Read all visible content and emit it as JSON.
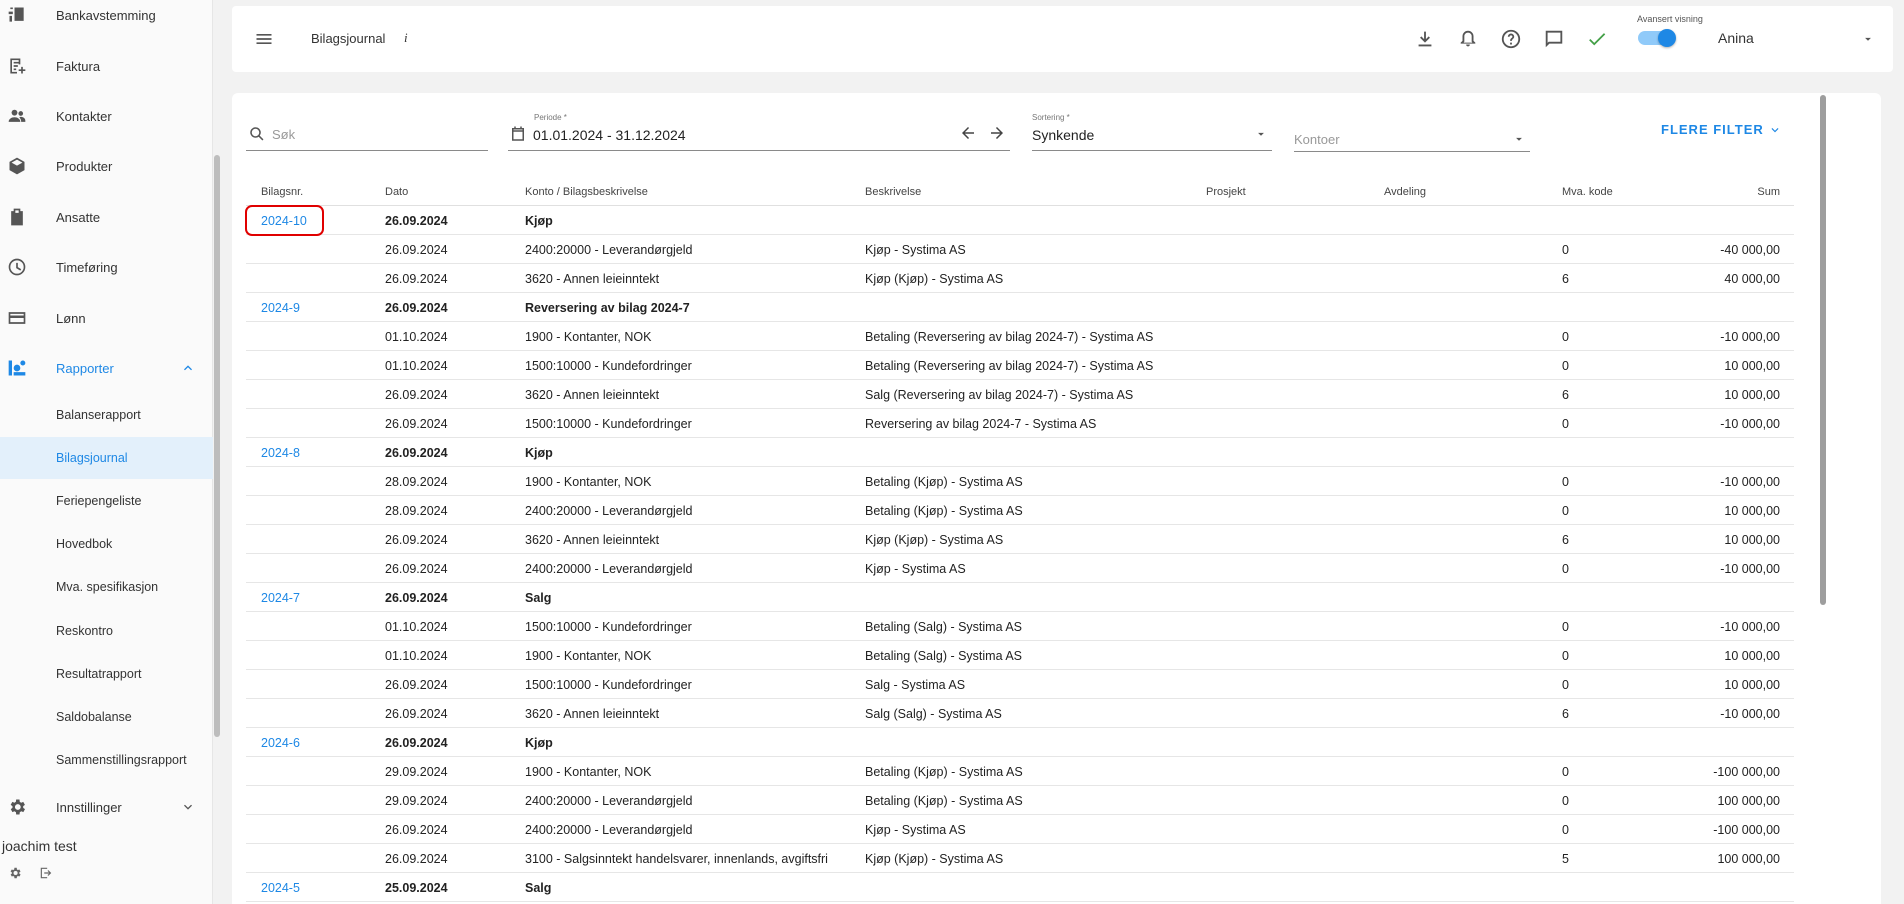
{
  "sidebar": {
    "items": [
      {
        "label": "Bankavstemming",
        "icon": "bank-reconciliation-icon"
      },
      {
        "label": "Faktura",
        "icon": "invoice-icon"
      },
      {
        "label": "Kontakter",
        "icon": "contacts-icon"
      },
      {
        "label": "Produkter",
        "icon": "products-box-icon"
      },
      {
        "label": "Ansatte",
        "icon": "employees-badge-icon"
      },
      {
        "label": "Timeføring",
        "icon": "clock-icon"
      },
      {
        "label": "Lønn",
        "icon": "payroll-card-icon"
      },
      {
        "label": "Rapporter",
        "icon": "reports-icon"
      }
    ],
    "report_subitems": [
      "Balanserapport",
      "Bilagsjournal",
      "Feriepengeliste",
      "Hovedbok",
      "Mva. spesifikasjon",
      "Reskontro",
      "Resultatrapport",
      "Saldobalanse",
      "Sammenstillingsrapport"
    ],
    "settings_label": "Innstillinger",
    "user_name": "joachim test"
  },
  "topbar": {
    "title": "Bilagsjournal",
    "info": "i",
    "advanced_view_label": "Avansert visning",
    "advanced_view_on": true,
    "user": "Anina",
    "accent": "#1e88e5"
  },
  "filters": {
    "search_placeholder": "Søk",
    "period_label": "Periode *",
    "period_value": "01.01.2024 - 31.12.2024",
    "sort_label": "Sortering *",
    "sort_value": "Synkende",
    "accounts_placeholder": "Kontoer",
    "more_filters": "FLERE FILTER"
  },
  "table": {
    "headers": {
      "bilagsnr": "Bilagsnr.",
      "dato": "Dato",
      "konto": "Konto / Bilagsbeskrivelse",
      "beskrivelse": "Beskrivelse",
      "prosjekt": "Prosjekt",
      "avdeling": "Avdeling",
      "mva": "Mva. kode",
      "sum": "Sum"
    },
    "rows": [
      {
        "type": "header",
        "nr": "2024-10",
        "date": "26.09.2024",
        "desc": "Kjøp"
      },
      {
        "type": "line",
        "date": "26.09.2024",
        "account": "2400:20000 - Leverandørgjeld",
        "text": "Kjøp - Systima AS",
        "mva": "0",
        "sum": "-40 000,00"
      },
      {
        "type": "line",
        "date": "26.09.2024",
        "account": "3620 - Annen leieinntekt",
        "text": "Kjøp (Kjøp) - Systima AS",
        "mva": "6",
        "sum": "40 000,00"
      },
      {
        "type": "header",
        "nr": "2024-9",
        "date": "26.09.2024",
        "desc": "Reversering av bilag 2024-7"
      },
      {
        "type": "line",
        "date": "01.10.2024",
        "account": "1900 - Kontanter, NOK",
        "text": "Betaling (Reversering av bilag 2024-7) - Systima AS",
        "mva": "0",
        "sum": "-10 000,00"
      },
      {
        "type": "line",
        "date": "01.10.2024",
        "account": "1500:10000 - Kundefordringer",
        "text": "Betaling (Reversering av bilag 2024-7) - Systima AS",
        "mva": "0",
        "sum": "10 000,00"
      },
      {
        "type": "line",
        "date": "26.09.2024",
        "account": "3620 - Annen leieinntekt",
        "text": "Salg (Reversering av bilag 2024-7) - Systima AS",
        "mva": "6",
        "sum": "10 000,00"
      },
      {
        "type": "line",
        "date": "26.09.2024",
        "account": "1500:10000 - Kundefordringer",
        "text": "Reversering av bilag 2024-7 - Systima AS",
        "mva": "0",
        "sum": "-10 000,00"
      },
      {
        "type": "header",
        "nr": "2024-8",
        "date": "26.09.2024",
        "desc": "Kjøp"
      },
      {
        "type": "line",
        "date": "28.09.2024",
        "account": "1900 - Kontanter, NOK",
        "text": "Betaling (Kjøp) - Systima AS",
        "mva": "0",
        "sum": "-10 000,00"
      },
      {
        "type": "line",
        "date": "28.09.2024",
        "account": "2400:20000 - Leverandørgjeld",
        "text": "Betaling (Kjøp) - Systima AS",
        "mva": "0",
        "sum": "10 000,00"
      },
      {
        "type": "line",
        "date": "26.09.2024",
        "account": "3620 - Annen leieinntekt",
        "text": "Kjøp (Kjøp) - Systima AS",
        "mva": "6",
        "sum": "10 000,00"
      },
      {
        "type": "line",
        "date": "26.09.2024",
        "account": "2400:20000 - Leverandørgjeld",
        "text": "Kjøp - Systima AS",
        "mva": "0",
        "sum": "-10 000,00"
      },
      {
        "type": "header",
        "nr": "2024-7",
        "date": "26.09.2024",
        "desc": "Salg"
      },
      {
        "type": "line",
        "date": "01.10.2024",
        "account": "1500:10000 - Kundefordringer",
        "text": "Betaling (Salg) - Systima AS",
        "mva": "0",
        "sum": "-10 000,00"
      },
      {
        "type": "line",
        "date": "01.10.2024",
        "account": "1900 - Kontanter, NOK",
        "text": "Betaling (Salg) - Systima AS",
        "mva": "0",
        "sum": "10 000,00"
      },
      {
        "type": "line",
        "date": "26.09.2024",
        "account": "1500:10000 - Kundefordringer",
        "text": "Salg - Systima AS",
        "mva": "0",
        "sum": "10 000,00"
      },
      {
        "type": "line",
        "date": "26.09.2024",
        "account": "3620 - Annen leieinntekt",
        "text": "Salg (Salg) - Systima AS",
        "mva": "6",
        "sum": "-10 000,00"
      },
      {
        "type": "header",
        "nr": "2024-6",
        "date": "26.09.2024",
        "desc": "Kjøp"
      },
      {
        "type": "line",
        "date": "29.09.2024",
        "account": "1900 - Kontanter, NOK",
        "text": "Betaling (Kjøp) - Systima AS",
        "mva": "0",
        "sum": "-100 000,00"
      },
      {
        "type": "line",
        "date": "29.09.2024",
        "account": "2400:20000 - Leverandørgjeld",
        "text": "Betaling (Kjøp) - Systima AS",
        "mva": "0",
        "sum": "100 000,00"
      },
      {
        "type": "line",
        "date": "26.09.2024",
        "account": "2400:20000 - Leverandørgjeld",
        "text": "Kjøp - Systima AS",
        "mva": "0",
        "sum": "-100 000,00"
      },
      {
        "type": "line",
        "date": "26.09.2024",
        "account": "3100 - Salgsinntekt handelsvarer, innenlands, avgiftsfri",
        "text": "Kjøp (Kjøp) - Systima AS",
        "mva": "5",
        "sum": "100 000,00"
      },
      {
        "type": "header",
        "nr": "2024-5",
        "date": "25.09.2024",
        "desc": "Salg"
      }
    ]
  }
}
